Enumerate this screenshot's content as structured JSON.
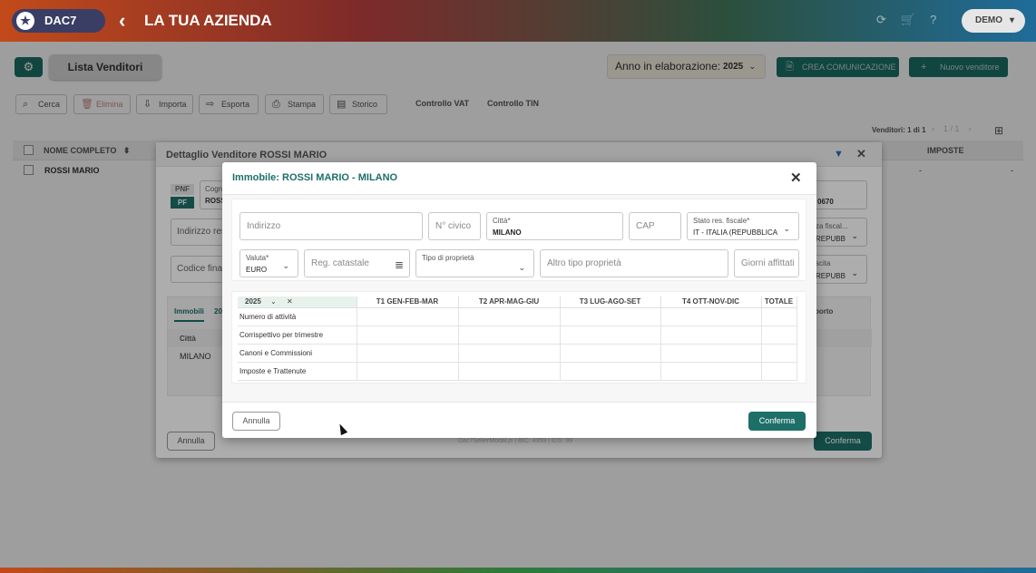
{
  "header": {
    "logo": "DAC7",
    "title": "LA TUA AZIENDA",
    "user": "DEMO"
  },
  "page": {
    "lista_label": "Lista Venditori",
    "anno_label": "Anno in elaborazione:",
    "anno_value": "2025",
    "crea_label": "CREA COMUNICAZIONE",
    "nuovo_label": "Nuovo venditore"
  },
  "toolbar": {
    "cerca": "Cerca",
    "elimina": "Elimina",
    "importa": "Importa",
    "esporta": "Esporta",
    "stampa": "Stampa",
    "storico": "Storico",
    "vat": "Controllo VAT",
    "tin": "Controllo TIN"
  },
  "list": {
    "count": "Venditori: 1 di 1",
    "pager": "1 / 1",
    "col_name": "NOME COMPLETO",
    "col_imposte": "IMPOSTE",
    "row_name": "ROSSI MARIO",
    "row_dash1": "-",
    "row_dash2": "-"
  },
  "detail": {
    "title": "Dettaglio Venditore ROSSI MARIO",
    "pnf": "PNF",
    "pf": "PF",
    "cogn_label": "Cogn",
    "cogn_value": "ROSS",
    "indirizzo_res": "Indirizzo res",
    "codice_fin": "Codice fina",
    "right_val": "0670",
    "right_lbl1": "za fiscal...",
    "right_val1": "REPUBB",
    "right_lbl2": "scita",
    "right_val2": "REPUBB",
    "tab_immobili": "Immobili",
    "tab_20": "20",
    "col_citta": "Città",
    "row_citta": "MILANO",
    "col_porto": "porto",
    "annulla": "Annulla",
    "conferma": "Conferma",
    "footer": "Dac7SellerModal.js | BIC: 4359 | IDS: 99"
  },
  "immobile": {
    "title": "Immobile: ROSSI MARIO - MILANO",
    "indirizzo_ph": "Indirizzo",
    "civico_ph": "N° civico",
    "citta_label": "Città*",
    "citta_value": "MILANO",
    "cap_ph": "CAP",
    "stato_label": "Stato res. fiscale*",
    "stato_value": "IT - ITALIA (REPUBBLICA",
    "valuta_label": "Valuta*",
    "valuta_value": "EURO",
    "reg_ph": "Reg. catastale",
    "tipo_label": "Tipo di proprietà",
    "altro_ph": "Altro tipo proprietà",
    "giorni_ph": "Giorni affittati",
    "annulla": "Annulla",
    "conferma": "Conferma"
  },
  "quarter_table": {
    "year": "2025",
    "columns": [
      "T1 GEN-FEB-MAR",
      "T2 APR-MAG-GIU",
      "T3 LUG-AGO-SET",
      "T4 OTT-NOV-DIC",
      "TOTALE"
    ],
    "rows": [
      "Numero di attività",
      "Corrispettivo per trimestre",
      "Canoni e Commissioni",
      "Imposte e Trattenute"
    ]
  },
  "colors": {
    "accent": "#1d6f68",
    "title_teal": "#1d6f68"
  }
}
